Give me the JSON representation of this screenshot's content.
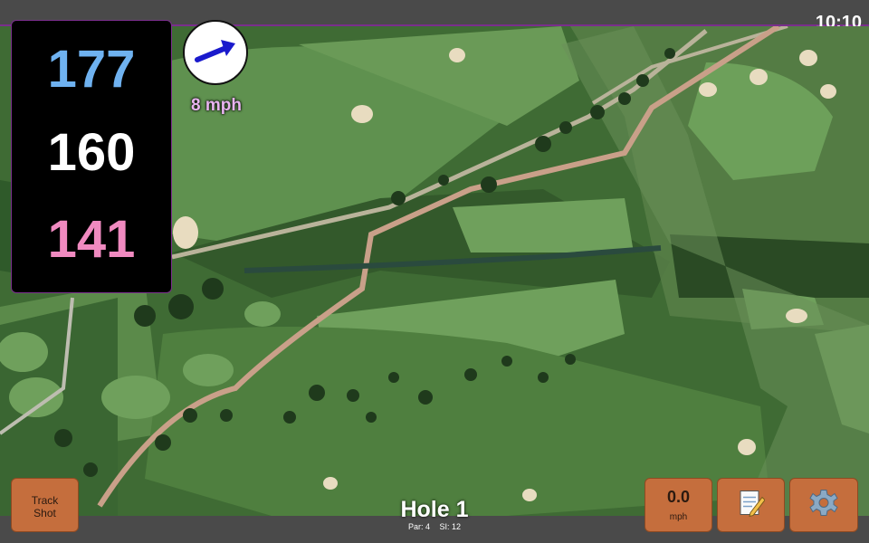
{
  "status_bar": {
    "time": "10:10"
  },
  "distances": {
    "back": "177",
    "middle": "160",
    "front": "141"
  },
  "wind": {
    "speed": "8 mph",
    "direction_icon": "arrow-right-up-icon"
  },
  "hole": {
    "title": "Hole 1",
    "par": "Par: 4",
    "stroke_index": "SI: 12"
  },
  "buttons": {
    "track_shot_line1": "Track",
    "track_shot_line2": "Shot",
    "speed_value": "0.0",
    "speed_unit": "mph",
    "notes_icon": "notepad-pencil-icon",
    "settings_icon": "gear-icon"
  },
  "colors": {
    "accent": "#7a2e8c",
    "button": "#c56e3d",
    "back_distance": "#6fb2f0",
    "middle_distance": "#ffffff",
    "front_distance": "#f08ac0",
    "wind_arrow": "#1a1acc"
  }
}
